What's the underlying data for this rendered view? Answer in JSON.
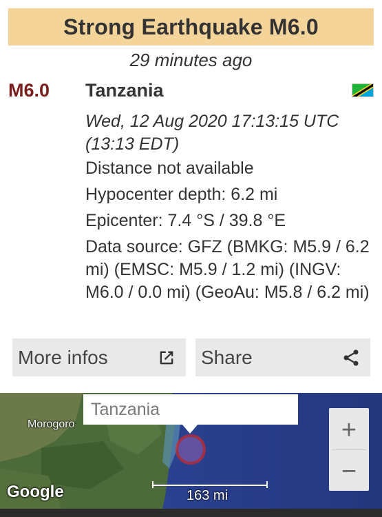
{
  "header": {
    "title": "Strong Earthquake M6.0",
    "time_ago": "29 minutes ago"
  },
  "quake": {
    "magnitude": "M6.0",
    "region": "Tanzania",
    "datetime_line1": "Wed, 12 Aug 2020 17:13:15 UTC",
    "datetime_line2": "(13:13 EDT)",
    "distance": "Distance not available",
    "depth": "Hypocenter depth: 6.2 mi",
    "epicenter": "Epicenter: 7.4 °S / 39.8 °E",
    "data_source": "Data source: GFZ (BMKG: M5.9 / 6.2 mi) (EMSC: M5.9 / 1.2 mi) (INGV: M6.0 / 0.0 mi) (GeoAu: M5.8 / 6.2 mi)",
    "flag_icon": "tanzania-flag-icon"
  },
  "actions": {
    "more_label": "More infos",
    "more_icon": "open-external-icon",
    "share_label": "Share",
    "share_icon": "share-icon"
  },
  "map": {
    "tooltip": "Tanzania",
    "city": "Morogoro",
    "scale": "163 mi",
    "attribution": "Google",
    "zoom_in": "+",
    "zoom_out": "−",
    "zoom_in_icon": "zoom-in-icon",
    "zoom_out_icon": "zoom-out-icon"
  },
  "colors": {
    "title_bg": "#f5d49a",
    "magnitude": "#7a1e1e",
    "button_bg": "#e9e9e9",
    "marker": "#d42a2a"
  }
}
